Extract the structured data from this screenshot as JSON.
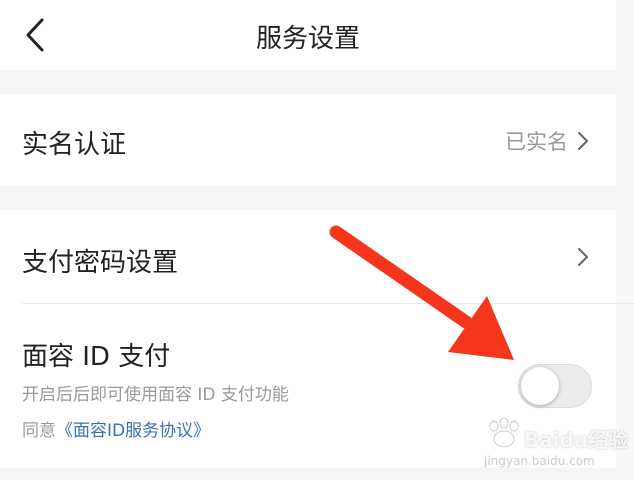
{
  "nav": {
    "title": "服务设置"
  },
  "realname": {
    "label": "实名认证",
    "value": "已实名"
  },
  "paypwd": {
    "label": "支付密码设置"
  },
  "faceid": {
    "label": "面容 ID 支付",
    "desc": "开启后后即可使用面容 ID 支付功能",
    "agree_prefix": "同意",
    "agree_link": "《面容ID服务协议》",
    "enabled": false
  },
  "watermark": {
    "logo": "Baidu经验",
    "url": "jingyan.baidu.com"
  },
  "colors": {
    "link": "#3b6fb6",
    "arrow": "#f5361c",
    "background": "#f5f5f7"
  }
}
